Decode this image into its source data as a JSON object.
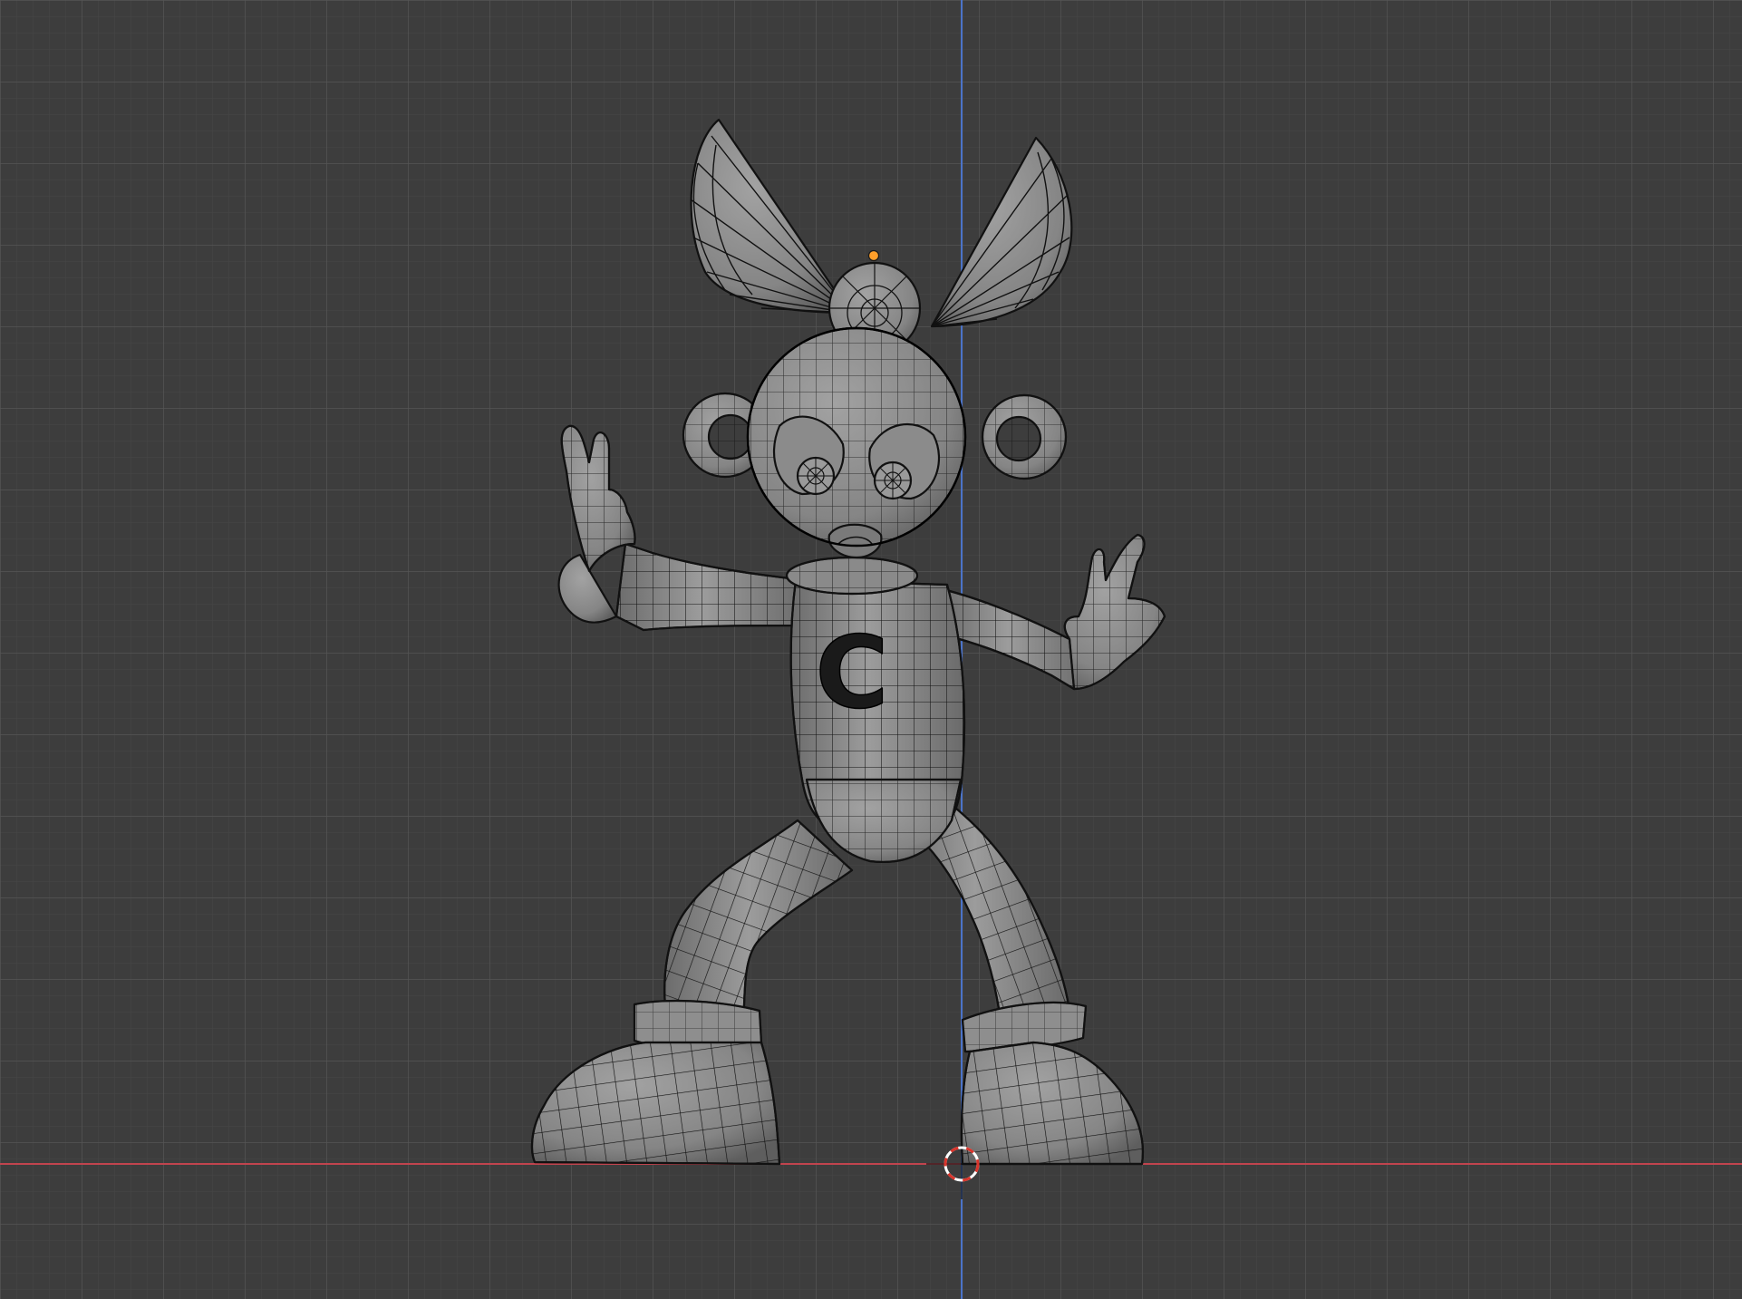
{
  "viewport": {
    "mode": "front-orthographic",
    "background_color": "#3d3d3d",
    "grid_minor_color": "#474747",
    "grid_major_color": "#525252",
    "x_axis_color": "#c1444e",
    "z_axis_color": "#4b73c9",
    "mesh_fill_color": "#7b7b7b",
    "wire_color": "#111111",
    "origin_color": "#ff9f2a"
  },
  "scene_objects": [
    {
      "name": "character-mesh",
      "type": "mesh",
      "shading": "solid",
      "overlay": "wireframe",
      "selected": false
    },
    {
      "name": "3d-cursor",
      "type": "cursor"
    },
    {
      "name": "object-origin",
      "type": "origin"
    }
  ],
  "chest_emblem": "C"
}
